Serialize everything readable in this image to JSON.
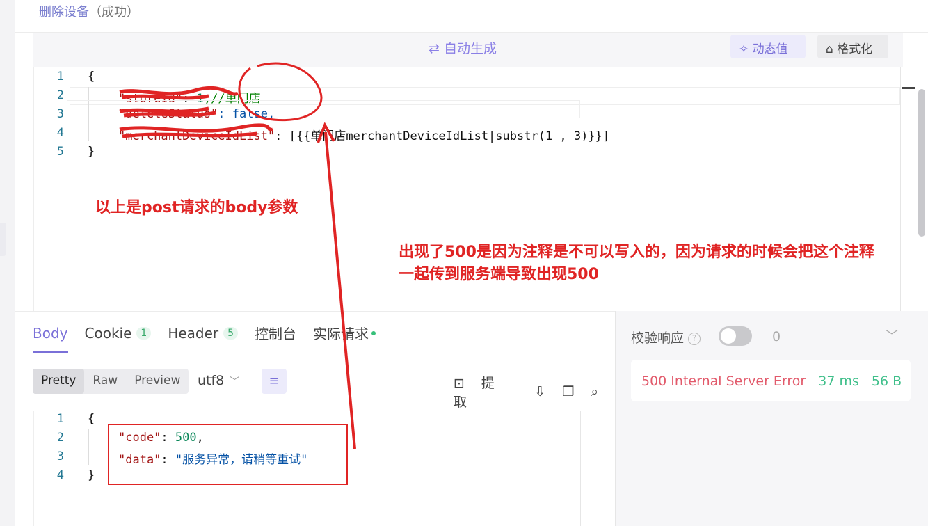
{
  "step": {
    "title": "删除设备",
    "status": "（成功）"
  },
  "editor": {
    "auto_generate": "自动生成",
    "dynamic_value": "动态值",
    "format": "格式化",
    "lines": [
      "1",
      "2",
      "3",
      "4",
      "5"
    ],
    "open_brace": "{",
    "close_brace": "}",
    "l2_key": "\"storeId\"",
    "l2_val": "1",
    "l2_comment": ",//单门店",
    "l3_key": "\"deleteStatus\"",
    "l3_val": ": false,",
    "l4_key": "\"merchantDeviceIdList\"",
    "l4_val_a": ": [{{",
    "l4_val_b": "单门店merchantDeviceIdList|substr(1 , 3)}}]"
  },
  "annotations": {
    "note1": "以上是post请求的body参数",
    "note2": "出现了500是因为注释是不可以写入的，因为请求的时候会把这个注释一起传到服务端导致出现500"
  },
  "response": {
    "tabs": [
      {
        "label": "Body"
      },
      {
        "label": "Cookie",
        "badge": "1"
      },
      {
        "label": "Header",
        "badge": "5"
      },
      {
        "label": "控制台"
      },
      {
        "label": "实际请求"
      }
    ],
    "view_modes": [
      "Pretty",
      "Raw",
      "Preview"
    ],
    "encoding": "utf8",
    "extract": "提取",
    "lines": [
      "1",
      "2",
      "3",
      "4"
    ],
    "open_brace": "{",
    "close_brace": "}",
    "code_key": "\"code\"",
    "code_val": "500",
    "data_key": "\"data\"",
    "data_val": "\"服务异常，请稍等重试\""
  },
  "verify": {
    "label": "校验响应",
    "count": "0",
    "status": "500 Internal Server Error",
    "time": "37 ms",
    "size": "56 B"
  },
  "colors": {
    "accent": "#7a70d8",
    "annotation": "#e02424",
    "error": "#e25a6b",
    "ok": "#3fbf8a"
  }
}
